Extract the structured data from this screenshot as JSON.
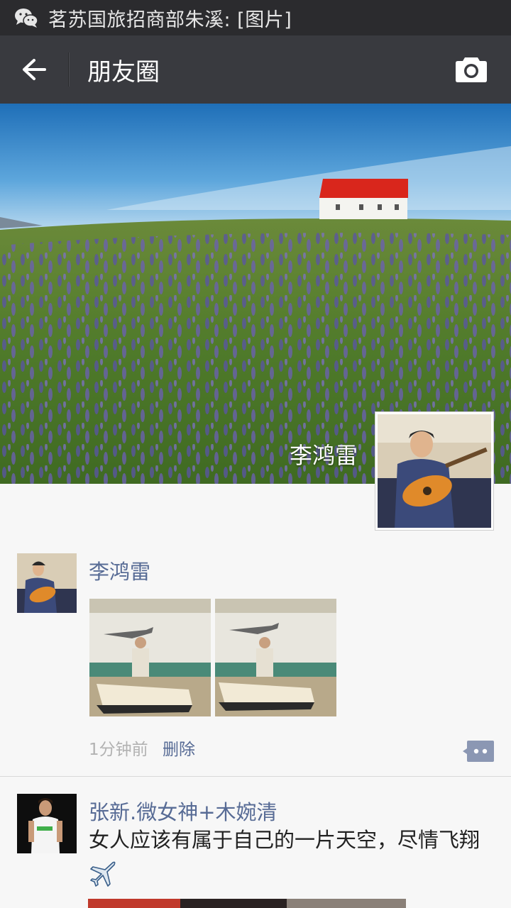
{
  "status_bar": {
    "app_icon": "wechat-icon",
    "notification": "茗苏国旅招商部朱溪: [图片]"
  },
  "header": {
    "back_icon": "arrow-left-icon",
    "title": "朋友圈",
    "camera_icon": "camera-icon"
  },
  "cover": {
    "owner_name": "李鸿雷",
    "image": "lupine-field-red-roof-house",
    "avatar": "man-playing-guitar"
  },
  "posts": [
    {
      "author": "李鸿雷",
      "avatar": "man-playing-guitar",
      "images": [
        "man-with-ship-and-airplane-model",
        "man-with-ship-and-airplane-model"
      ],
      "time": "1分钟前",
      "delete_label": "删除",
      "comment_icon": "comment-dots-icon"
    },
    {
      "author": "张新.微女神+木婉清",
      "avatar": "woman-white-tshirt",
      "text": "女人应该有属于自己的一片天空，尽情飞翔",
      "emoji": "airplane-emoji"
    }
  ],
  "colors": {
    "status_bar_bg": "#2b2b2e",
    "app_bar_bg": "#393a3f",
    "name_link": "#576b95",
    "time_gray": "#b2b2b2",
    "feed_bg": "#f7f7f7"
  }
}
